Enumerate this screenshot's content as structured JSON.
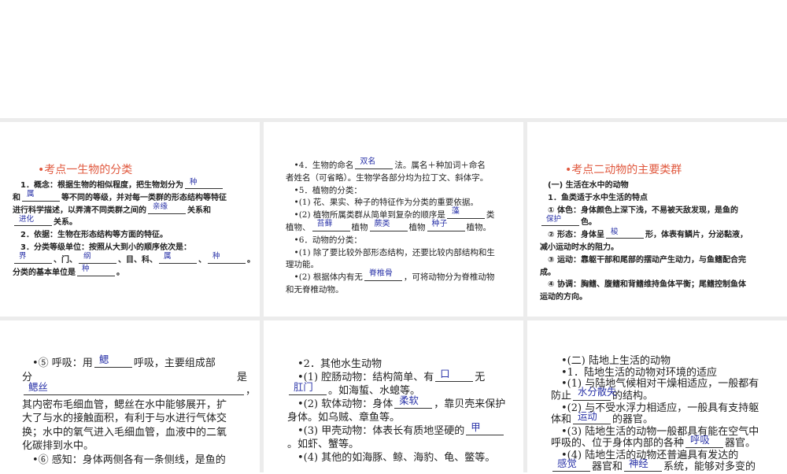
{
  "accent_color": "#e0583e",
  "answer_color": "#2a33a8",
  "panels": [
    {
      "id": "p1",
      "title": "•考点一生物的分类",
      "lines": [
        [
          "　1．概念：根据生物的相似程度，把生物划分为",
          {
            "a": "种"
          }
        ],
        [
          "和",
          {
            "a": "属"
          },
          "等不同的等级，并对每一类群的形态结构等特征"
        ],
        [
          "进行科学描述，以弄清不同类群之间的",
          {
            "a": "亲缘"
          },
          "关系和"
        ],
        [
          {
            "a": "进化"
          },
          "关系。"
        ],
        [
          "　2．依据：生物在形态结构等方面的特征。"
        ],
        [
          "　3．分类等级单位：按照从大到小的顺序依次是："
        ],
        [
          {
            "a": "界"
          },
          "、门、",
          {
            "a": "纲"
          },
          "、目、科、",
          {
            "a": "属"
          },
          "、",
          {
            "a": "种"
          },
          "。"
        ],
        [
          "分类的基本单位是",
          {
            "a": "种"
          },
          "。"
        ]
      ]
    },
    {
      "id": "p2",
      "lines": [
        [
          "　•4．生物的命名",
          {
            "a": "双名"
          },
          "法。属名＋种加词＋命名"
        ],
        [
          "者姓名（可省略）。生物学各部分均为拉丁文、斜体字。"
        ],
        [
          "　•5．植物的分类："
        ],
        [
          "　•(1) 花、果实、种子的特征作为分类的重要依据。"
        ],
        [
          "　•(2) 植物所属类群从简单到复杂的顺序是",
          {
            "a": "藻"
          },
          "类"
        ],
        [
          "植物、",
          {
            "a": "苔藓"
          },
          "植物",
          {
            "a": "蕨类"
          },
          "植物",
          {
            "a": "种子"
          },
          "植物。"
        ],
        [
          "　•6．动物的分类："
        ],
        [
          "　•(1) 除了要比较外部形态结构，还要比较内部结构和生"
        ],
        [
          "理功能。"
        ],
        [
          "　•(2) 根据体内有无",
          {
            "a": "脊椎骨"
          },
          "，可将动物分为脊椎动物"
        ],
        [
          "和无脊椎动物。"
        ]
      ]
    },
    {
      "id": "p3",
      "title": "•考点二动物的主要类群",
      "lines": [
        [
          "　(一) 生活在水中的动物"
        ],
        [
          "　1．鱼类适于水中生活的特点"
        ],
        [
          "　① 体色：身体颜色上深下浅，不易被天敌发现，是鱼的"
        ],
        [
          {
            "a": "保护"
          },
          "色。"
        ],
        [
          "　② 形态：身体呈",
          {
            "a": "梭"
          },
          "形，体表有鳞片，分泌黏液，"
        ],
        [
          "减小运动时水的阻力。"
        ],
        [
          "　③ 运动：靠躯干部和尾部的摆动产生动力，与鱼鳍配合完"
        ],
        [
          "成。"
        ],
        [
          "　④ 协调：胸鳍、腹鳍和背鳍维持鱼体平衡；尾鳍控制鱼体"
        ],
        [
          "运动的方向。"
        ]
      ]
    },
    {
      "id": "p4",
      "lines": [
        [
          "　•⑤ 呼吸：用",
          {
            "a": "鳃"
          },
          "呼吸，主要组成部"
        ],
        [
          "分　　　　　　　　　　　　　　　　　　　　是"
        ],
        [
          {
            "a": "鳃丝",
            "w": true
          },
          "，"
        ],
        [
          "其内密布毛细血管，鳃丝在水中能够展开，扩"
        ],
        [
          "大了与水的接触面积，有利于与水进行气体交"
        ],
        [
          "换；水中的氧气进入毛细血管，血液中的二氧"
        ],
        [
          "化碳排到水中。"
        ],
        [
          "　•⑥ 感知：身体两侧各有一条侧线，是鱼的"
        ]
      ]
    },
    {
      "id": "p5",
      "lines": [
        [
          "　•2．其他水生动物"
        ],
        [
          "　•(1) 腔肠动物：结构简单、有",
          {
            "a": "口"
          },
          "无"
        ],
        [
          {
            "a": "肛门"
          },
          "。如海蜇、水螅等。"
        ],
        [
          "　•(2) 软体动物：身体",
          {
            "a": "柔软"
          },
          "，靠贝壳来保护"
        ],
        [
          "身体。如乌贼、章鱼等。"
        ],
        [
          "　•(3) 甲壳动物：体表长有质地坚硬的",
          {
            "a": "甲"
          }
        ],
        [
          "。如虾、蟹等。"
        ],
        [
          "　•(4) 其他的如海豚、鲸、海豹、龟、鳖等。"
        ]
      ]
    },
    {
      "id": "p6",
      "lines": [
        [
          "　•(二) 陆地上生活的动物"
        ],
        [
          "　•1．陆地生活的动物对环境的适应"
        ],
        [
          "　•(1) 与陆地气候相对干燥相适应，一般都有"
        ],
        [
          "防止",
          {
            "a": "水分散失"
          },
          "的结构。"
        ],
        [
          "　•(2) 与不受水浮力相适应，一般具有支持躯"
        ],
        [
          "体和",
          {
            "a": "运动"
          },
          "的器官。"
        ],
        [
          "　•(3) 陆地生活的动物一般都具有能在空气中"
        ],
        [
          "呼吸的、位于身体内部的各种",
          {
            "a": "呼吸"
          },
          "器官。"
        ],
        [
          "　•(4) 陆地生活的动物还普遍具有发达的"
        ],
        [
          {
            "a": "感觉"
          },
          "器官和",
          {
            "a": "神经"
          },
          "系统，能够对多变的"
        ]
      ]
    }
  ]
}
